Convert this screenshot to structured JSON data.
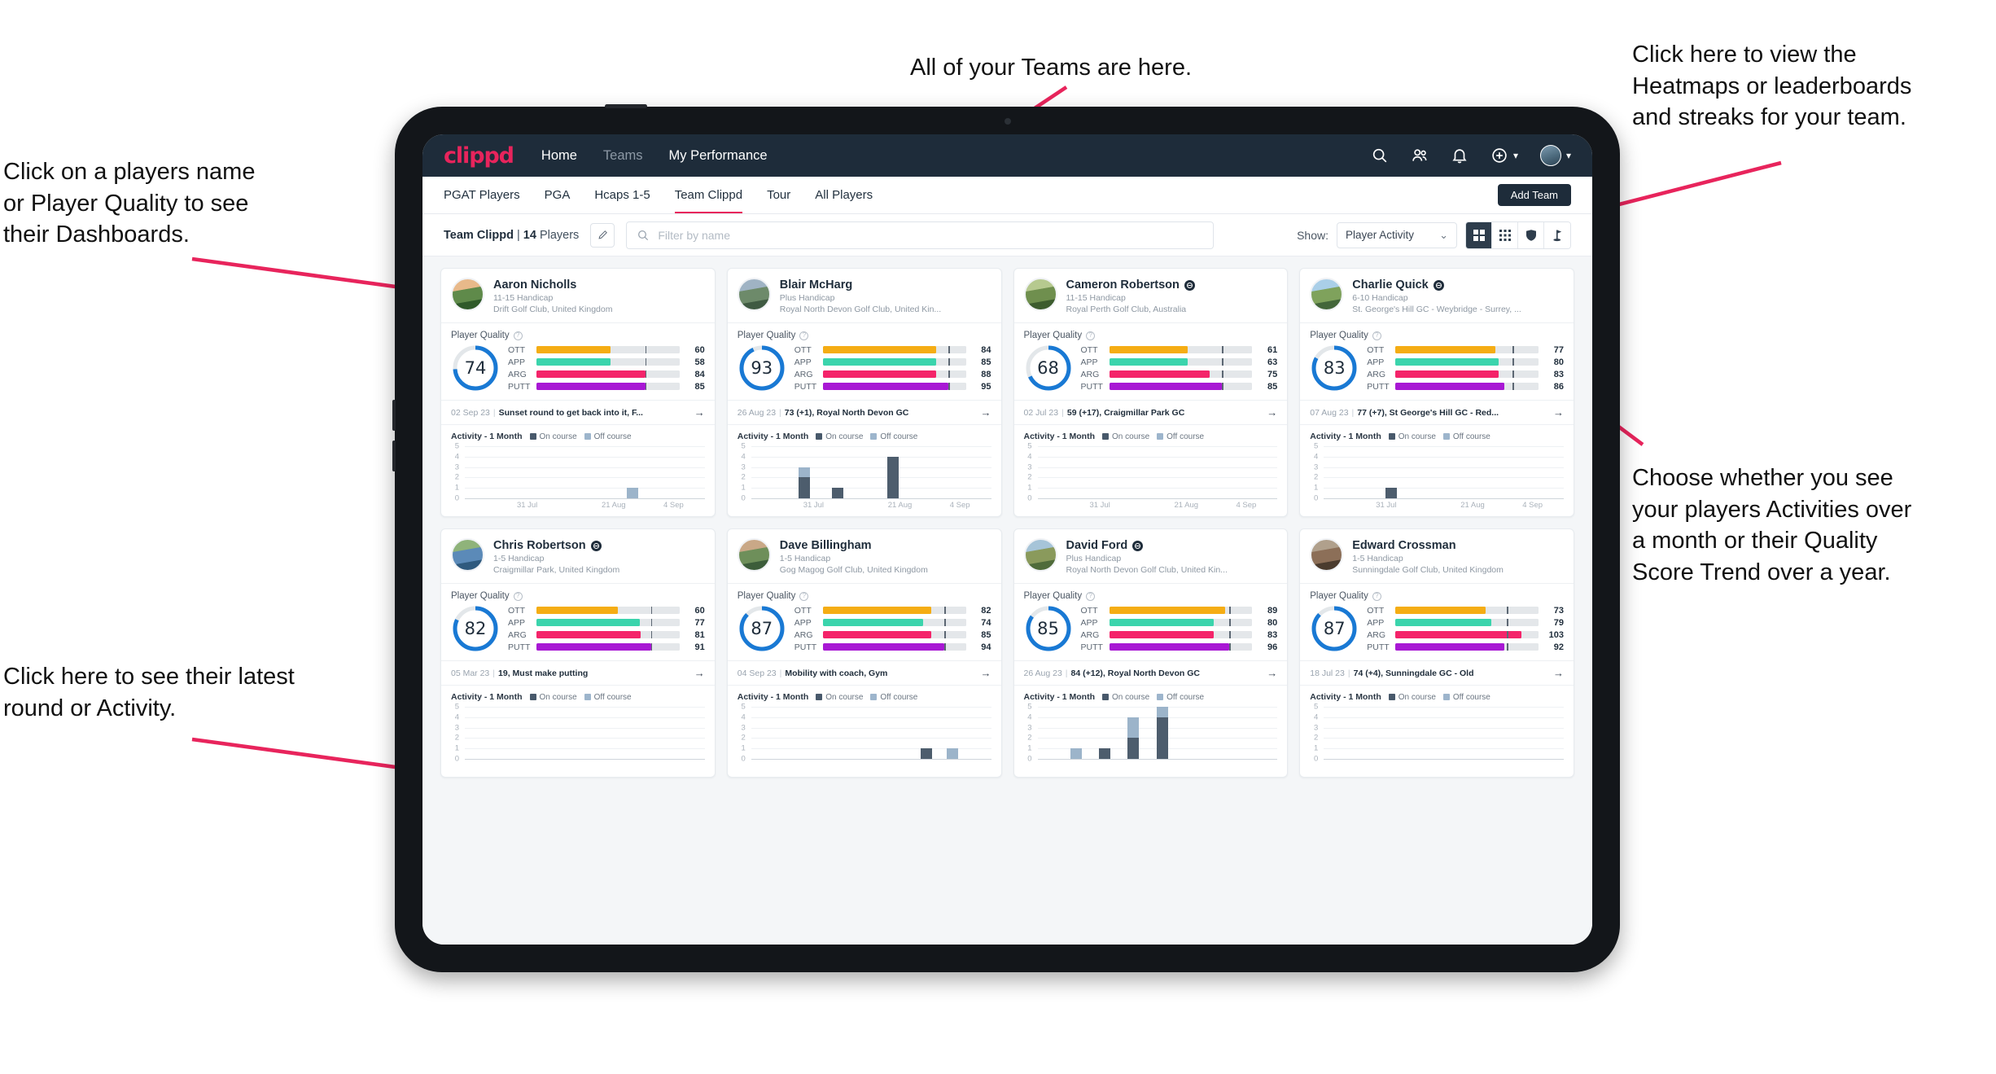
{
  "annotations": [
    {
      "id": "teams",
      "text": "All of your Teams are here."
    },
    {
      "id": "heatmaps",
      "text": "Click here to view the\nHeatmaps or leaderboards\nand streaks for your team."
    },
    {
      "id": "names",
      "text": "Click on a players name\nor Player Quality to see\ntheir Dashboards."
    },
    {
      "id": "activity-toggle",
      "text": "Choose whether you see\nyour players Activities over\na month or their Quality\nScore Trend over a year."
    },
    {
      "id": "latest",
      "text": "Click here to see their latest\nround or Activity."
    }
  ],
  "navbar": {
    "logo": "clippd",
    "links": [
      {
        "label": "Home",
        "active": true
      },
      {
        "label": "Teams",
        "active": false
      },
      {
        "label": "My Performance",
        "active": true
      }
    ],
    "icons": [
      "search-icon",
      "people-icon",
      "bell-icon",
      "plus-circle-icon",
      "avatar"
    ]
  },
  "tabs": {
    "items": [
      {
        "label": "PGAT Players",
        "state": "normal"
      },
      {
        "label": "PGA",
        "state": "normal"
      },
      {
        "label": "Hcaps 1-5",
        "state": "normal"
      },
      {
        "label": "Team Clippd",
        "state": "active"
      },
      {
        "label": "Tour",
        "state": "normal"
      },
      {
        "label": "All Players",
        "state": "normal"
      }
    ],
    "add_team_label": "Add Team"
  },
  "filter_bar": {
    "team_name": "Team Clippd",
    "separator": "|",
    "player_count": "14",
    "players_word": "Players",
    "edit_icon": "pencil-icon",
    "search_placeholder": "Filter by name",
    "search_value": "",
    "show_label": "Show:",
    "show_value": "Player Activity",
    "view_buttons": [
      {
        "name": "grid-view",
        "icon": "grid-2x2-icon",
        "active": true
      },
      {
        "name": "dense-grid-view",
        "icon": "grid-dots-icon",
        "active": false
      },
      {
        "name": "heatmap-view",
        "icon": "shield-icon",
        "active": false
      },
      {
        "name": "leaderboard-view",
        "icon": "flag-icon",
        "active": false
      }
    ]
  },
  "card_labels": {
    "player_quality": "Player Quality",
    "activity_title": "Activity - 1 Month",
    "legend_on": "On course",
    "legend_off": "Off course",
    "metric_labels": [
      "OTT",
      "APP",
      "ARG",
      "PUTT"
    ],
    "arrow": "→"
  },
  "colors": {
    "brand": "#e8245c",
    "nav_bg": "#1e2c3a",
    "ring": "#1979d4",
    "ott": "#f5ad14",
    "app": "#3bd4ac",
    "arg": "#f4246a",
    "putt": "#a818d4",
    "on_course": "#4d5d6d",
    "off_course": "#9cb4ca"
  },
  "chart_data": {
    "type": "bar",
    "title": "Activity - 1 Month",
    "ylabel": "",
    "xlabel": "",
    "ylim": [
      0,
      5
    ],
    "yticks": [
      0,
      1,
      2,
      3,
      4,
      5
    ],
    "grid": true,
    "legend": [
      "On course",
      "Off course"
    ],
    "xticklabels": [
      "31 Jul",
      "21 Aug",
      "4 Sep"
    ],
    "xtick_positions": [
      0.26,
      0.62,
      0.87
    ],
    "series_names": [
      "On course",
      "Off course"
    ]
  },
  "players": [
    {
      "name": "Aaron Nicholls",
      "verified": false,
      "handicap": "11-15 Handicap",
      "club": "Drift Golf Club, United Kingdom",
      "avatar_colors": [
        "#e8b98a",
        "#5f8a4a",
        "#2f5a2a"
      ],
      "quality": 74,
      "ring_pct": 74,
      "metrics": [
        {
          "label": "OTT",
          "value": 60,
          "fill_pct": 52,
          "tick_pct": 76
        },
        {
          "label": "APP",
          "value": 58,
          "fill_pct": 52,
          "tick_pct": 76
        },
        {
          "label": "ARG",
          "value": 84,
          "fill_pct": 76,
          "tick_pct": 76
        },
        {
          "label": "PUTT",
          "value": 85,
          "fill_pct": 76,
          "tick_pct": 76
        }
      ],
      "latest": {
        "date": "02 Sep 23",
        "text": "Sunset round to get back into it, F..."
      },
      "activity": {
        "bars": [
          {
            "x": 0.7,
            "on": 0,
            "off": 1
          }
        ]
      }
    },
    {
      "name": "Blair McHarg",
      "verified": false,
      "handicap": "Plus Handicap",
      "club": "Royal North Devon Golf Club, United Kin...",
      "avatar_colors": [
        "#9fb3c4",
        "#6d8a6a",
        "#3f5a42"
      ],
      "quality": 93,
      "ring_pct": 93,
      "metrics": [
        {
          "label": "OTT",
          "value": 84,
          "fill_pct": 79,
          "tick_pct": 88
        },
        {
          "label": "APP",
          "value": 85,
          "fill_pct": 79,
          "tick_pct": 88
        },
        {
          "label": "ARG",
          "value": 88,
          "fill_pct": 79,
          "tick_pct": 88
        },
        {
          "label": "PUTT",
          "value": 95,
          "fill_pct": 88,
          "tick_pct": 88
        }
      ],
      "latest": {
        "date": "26 Aug 23",
        "text": "73 (+1), Royal North Devon GC"
      },
      "activity": {
        "bars": [
          {
            "x": 0.22,
            "on": 2,
            "off": 1
          },
          {
            "x": 0.36,
            "on": 1,
            "off": 0
          },
          {
            "x": 0.59,
            "on": 4,
            "off": 0
          }
        ]
      }
    },
    {
      "name": "Cameron Robertson",
      "verified": true,
      "handicap": "11-15 Handicap",
      "club": "Royal Perth Golf Club, Australia",
      "avatar_colors": [
        "#b6c98f",
        "#6f8f4e",
        "#3d5c2e"
      ],
      "quality": 68,
      "ring_pct": 68,
      "metrics": [
        {
          "label": "OTT",
          "value": 61,
          "fill_pct": 55,
          "tick_pct": 79
        },
        {
          "label": "APP",
          "value": 63,
          "fill_pct": 55,
          "tick_pct": 79
        },
        {
          "label": "ARG",
          "value": 75,
          "fill_pct": 70,
          "tick_pct": 79
        },
        {
          "label": "PUTT",
          "value": 85,
          "fill_pct": 79,
          "tick_pct": 79
        }
      ],
      "latest": {
        "date": "02 Jul 23",
        "text": "59 (+17), Craigmillar Park GC"
      },
      "activity": {
        "bars": []
      }
    },
    {
      "name": "Charlie Quick",
      "verified": true,
      "handicap": "6-10 Handicap",
      "club": "St. George's Hill GC - Weybridge - Surrey, ...",
      "avatar_colors": [
        "#aacfe8",
        "#7fa25c",
        "#43663a"
      ],
      "quality": 83,
      "ring_pct": 83,
      "metrics": [
        {
          "label": "OTT",
          "value": 77,
          "fill_pct": 70,
          "tick_pct": 82
        },
        {
          "label": "APP",
          "value": 80,
          "fill_pct": 72,
          "tick_pct": 82
        },
        {
          "label": "ARG",
          "value": 83,
          "fill_pct": 72,
          "tick_pct": 82
        },
        {
          "label": "PUTT",
          "value": 86,
          "fill_pct": 76,
          "tick_pct": 82
        }
      ],
      "latest": {
        "date": "07 Aug 23",
        "text": "77 (+7), St George's Hill GC - Red..."
      },
      "activity": {
        "bars": [
          {
            "x": 0.28,
            "on": 1,
            "off": 0
          }
        ]
      }
    },
    {
      "name": "Chris Robertson",
      "verified": true,
      "handicap": "1-5 Handicap",
      "club": "Craigmillar Park, United Kingdom",
      "avatar_colors": [
        "#8fb37a",
        "#5b8ab8",
        "#2f5a7e"
      ],
      "quality": 82,
      "ring_pct": 82,
      "metrics": [
        {
          "label": "OTT",
          "value": 60,
          "fill_pct": 57,
          "tick_pct": 80
        },
        {
          "label": "APP",
          "value": 77,
          "fill_pct": 72,
          "tick_pct": 80
        },
        {
          "label": "ARG",
          "value": 81,
          "fill_pct": 73,
          "tick_pct": 80
        },
        {
          "label": "PUTT",
          "value": 91,
          "fill_pct": 80,
          "tick_pct": 80
        }
      ],
      "latest": {
        "date": "05 Mar 23",
        "text": "19, Must make putting"
      },
      "activity": {
        "bars": []
      }
    },
    {
      "name": "Dave Billingham",
      "verified": false,
      "handicap": "1-5 Handicap",
      "club": "Gog Magog Golf Club, United Kingdom",
      "avatar_colors": [
        "#c9a887",
        "#6e8f5a",
        "#3c5d3a"
      ],
      "quality": 87,
      "ring_pct": 87,
      "metrics": [
        {
          "label": "OTT",
          "value": 82,
          "fill_pct": 76,
          "tick_pct": 85
        },
        {
          "label": "APP",
          "value": 74,
          "fill_pct": 70,
          "tick_pct": 85
        },
        {
          "label": "ARG",
          "value": 85,
          "fill_pct": 76,
          "tick_pct": 85
        },
        {
          "label": "PUTT",
          "value": 94,
          "fill_pct": 85,
          "tick_pct": 85
        }
      ],
      "latest": {
        "date": "04 Sep 23",
        "text": "Mobility with coach, Gym"
      },
      "activity": {
        "bars": [
          {
            "x": 0.73,
            "on": 1,
            "off": 0
          },
          {
            "x": 0.84,
            "on": 0,
            "off": 1
          }
        ]
      }
    },
    {
      "name": "David Ford",
      "verified": true,
      "handicap": "Plus Handicap",
      "club": "Royal North Devon Golf Club, United Kin...",
      "avatar_colors": [
        "#a6c4d8",
        "#8a9a5c",
        "#4f6b3a"
      ],
      "quality": 85,
      "ring_pct": 85,
      "metrics": [
        {
          "label": "OTT",
          "value": 89,
          "fill_pct": 81,
          "tick_pct": 84
        },
        {
          "label": "APP",
          "value": 80,
          "fill_pct": 73,
          "tick_pct": 84
        },
        {
          "label": "ARG",
          "value": 83,
          "fill_pct": 73,
          "tick_pct": 84
        },
        {
          "label": "PUTT",
          "value": 96,
          "fill_pct": 84,
          "tick_pct": 84
        }
      ],
      "latest": {
        "date": "26 Aug 23",
        "text": "84 (+12), Royal North Devon GC"
      },
      "activity": {
        "bars": [
          {
            "x": 0.16,
            "on": 0,
            "off": 1
          },
          {
            "x": 0.28,
            "on": 1,
            "off": 0
          },
          {
            "x": 0.4,
            "on": 2,
            "off": 2
          },
          {
            "x": 0.52,
            "on": 4,
            "off": 1
          }
        ]
      }
    },
    {
      "name": "Edward Crossman",
      "verified": false,
      "handicap": "1-5 Handicap",
      "club": "Sunningdale Golf Club, United Kingdom",
      "avatar_colors": [
        "#b0a08c",
        "#8c6f58",
        "#4a3b2e"
      ],
      "quality": 87,
      "ring_pct": 87,
      "metrics": [
        {
          "label": "OTT",
          "value": 73,
          "fill_pct": 63,
          "tick_pct": 78
        },
        {
          "label": "APP",
          "value": 79,
          "fill_pct": 67,
          "tick_pct": 78
        },
        {
          "label": "ARG",
          "value": 103,
          "fill_pct": 88,
          "tick_pct": 78
        },
        {
          "label": "PUTT",
          "value": 92,
          "fill_pct": 76,
          "tick_pct": 78
        }
      ],
      "latest": {
        "date": "18 Jul 23",
        "text": "74 (+4), Sunningdale GC - Old"
      },
      "activity": {
        "bars": []
      }
    }
  ]
}
